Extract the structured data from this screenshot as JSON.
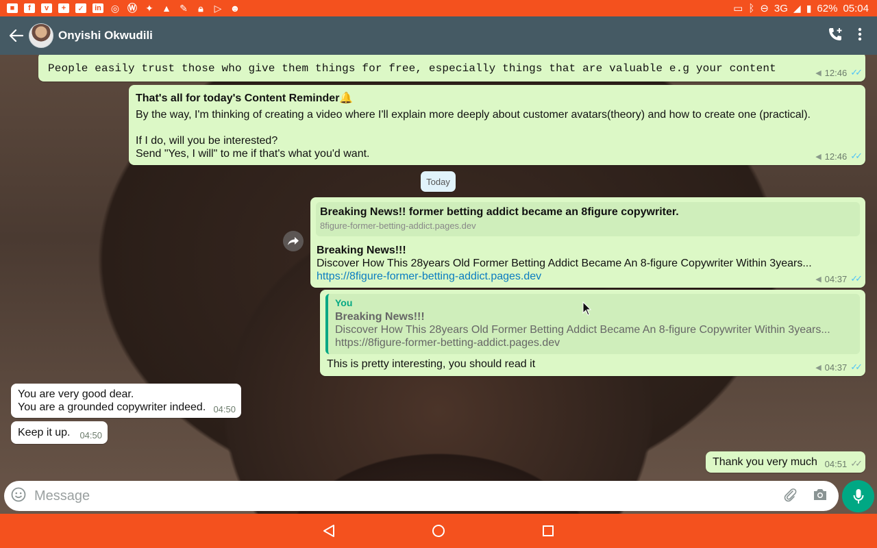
{
  "status_bar": {
    "left_icons": [
      "video-icon",
      "facebook-icon",
      "vimeo-icon",
      "plus-app-icon",
      "pocket-icon",
      "linkedin-icon",
      "chrome-icon",
      "wordpress-icon",
      "twitter-icon",
      "warning-icon",
      "edit-icon",
      "lock-icon",
      "play-store-icon",
      "discord-icon"
    ],
    "network": "3G",
    "battery": "62%",
    "time": "05:04"
  },
  "header": {
    "contact_name": "Onyishi Okwudili"
  },
  "messages": {
    "m1": {
      "text": "People easily trust those who give them things for free, especially things that are valuable e.g your content",
      "time": "12:46"
    },
    "m2": {
      "title": "That's all for today's Content Reminder🔔",
      "line1": "By the way, I'm thinking of creating a video where I'll explain more deeply about customer avatars(theory) and how to create one (practical).",
      "line2": "If I do, will you be interested?",
      "line3": "Send \"Yes, I will\" to me if that's what you'd want.",
      "time": "12:46"
    },
    "date_divider": "Today",
    "m3": {
      "preview_title": "Breaking News!! former betting addict became an 8figure copywriter.",
      "preview_domain": "8figure-former-betting-addict.pages.dev",
      "title": "Breaking News!!!",
      "body": "Discover How This 28years Old Former Betting Addict Became An 8-figure Copywriter Within 3years...",
      "link": "https://8figure-former-betting-addict.pages.dev",
      "time": "04:37"
    },
    "m4": {
      "quote_author": "You",
      "quote_title": "Breaking News!!!",
      "quote_body": "Discover How This 28years Old Former Betting Addict Became An 8-figure Copywriter Within 3years...",
      "quote_link": "https://8figure-former-betting-addict.pages.dev",
      "text": "This is pretty interesting, you should read it",
      "time": "04:37"
    },
    "m5": {
      "line1": "You are very good dear.",
      "line2": "You are a grounded copywriter indeed.",
      "time": "04:50"
    },
    "m6": {
      "text": "Keep it up.",
      "time": "04:50"
    },
    "m7": {
      "text": "Thank you very much",
      "time": "04:51"
    }
  },
  "composer": {
    "placeholder": "Message"
  },
  "colors": {
    "accent": "#f4511e",
    "header": "#455a64",
    "outgoing": "#dcf8c6",
    "send": "#00a884",
    "read_ticks": "#4fc3f7"
  }
}
